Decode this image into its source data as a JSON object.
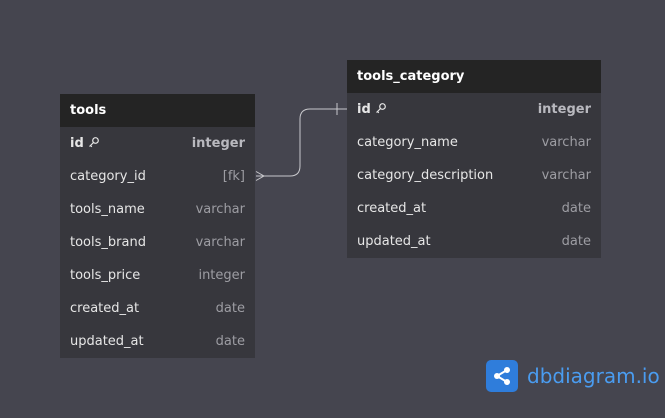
{
  "tables": {
    "tools": {
      "title": "tools",
      "columns": [
        {
          "name": "id",
          "type": "integer",
          "pk": true
        },
        {
          "name": "category_id",
          "type": "[fk]"
        },
        {
          "name": "tools_name",
          "type": "varchar"
        },
        {
          "name": "tools_brand",
          "type": "varchar"
        },
        {
          "name": "tools_price",
          "type": "integer"
        },
        {
          "name": "created_at",
          "type": "date"
        },
        {
          "name": "updated_at",
          "type": "date"
        }
      ]
    },
    "tools_category": {
      "title": "tools_category",
      "columns": [
        {
          "name": "id",
          "type": "integer",
          "pk": true
        },
        {
          "name": "category_name",
          "type": "varchar"
        },
        {
          "name": "category_description",
          "type": "varchar"
        },
        {
          "name": "created_at",
          "type": "date"
        },
        {
          "name": "updated_at",
          "type": "date"
        }
      ]
    }
  },
  "relationship": {
    "from": "tools.category_id",
    "to": "tools_category.id",
    "from_cardinality": "many",
    "to_cardinality": "one"
  },
  "brand": {
    "name": "dbdiagram",
    "suffix": ".io",
    "icon": "share-nodes-icon"
  },
  "colors": {
    "canvas": "#45454f",
    "table_body": "#37373d",
    "table_header": "#242424",
    "brand_blue": "#2f7ddb"
  }
}
